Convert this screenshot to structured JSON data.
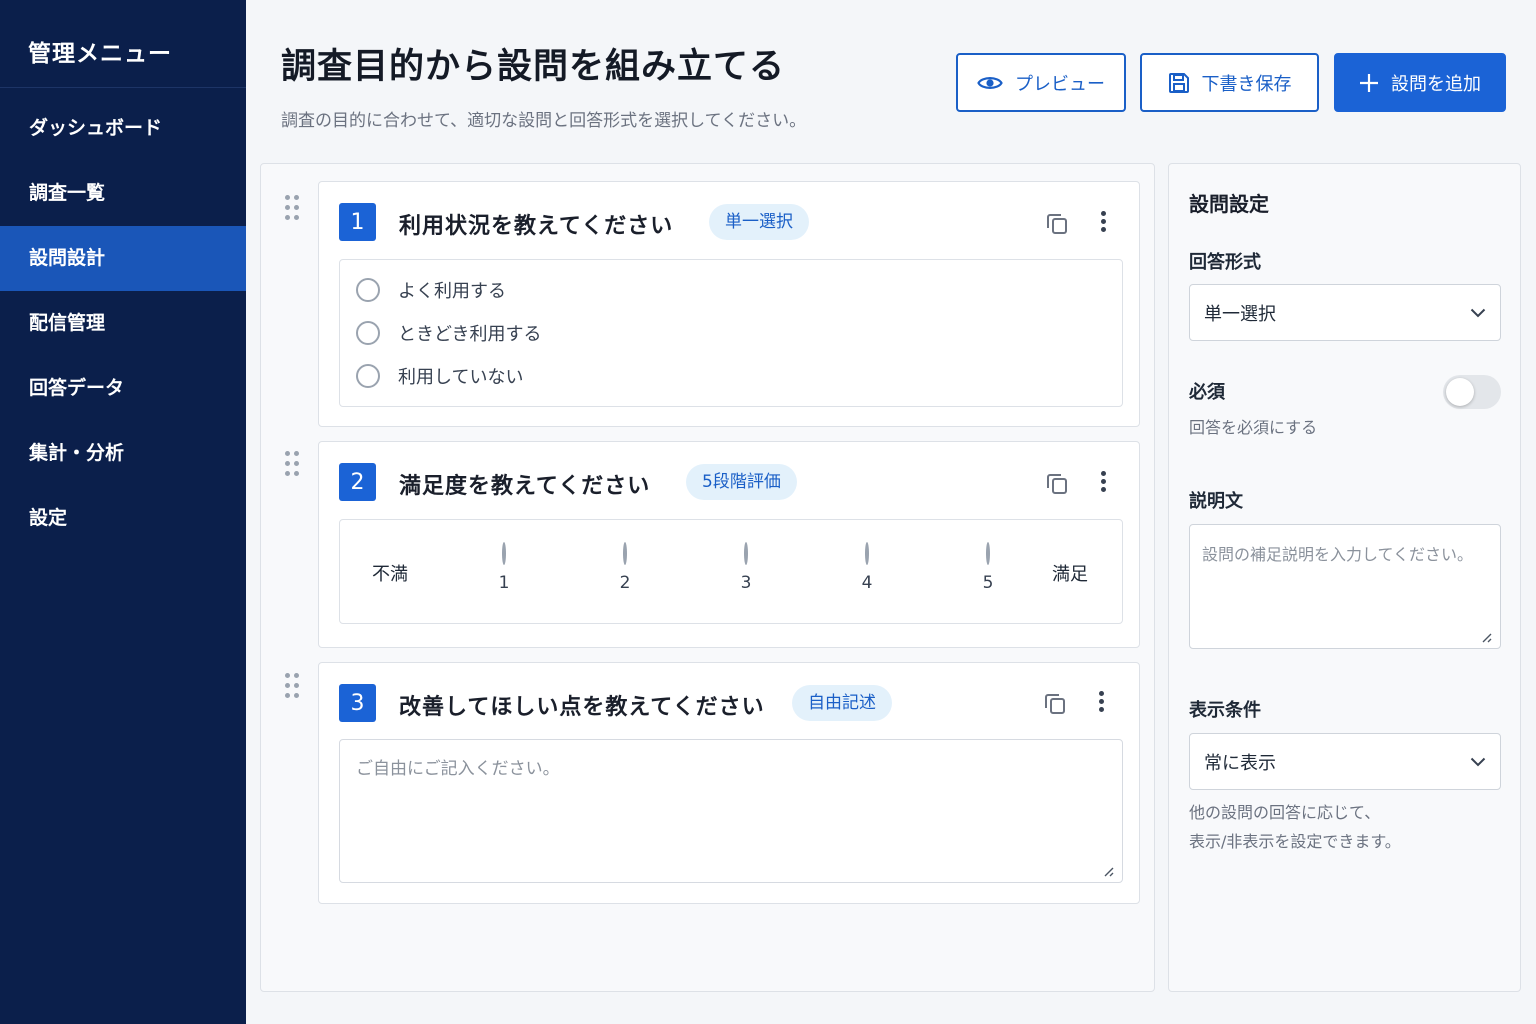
{
  "sidebar": {
    "title": "管理メニュー",
    "items": [
      {
        "label": "ダッシュボード"
      },
      {
        "label": "調査一覧"
      },
      {
        "label": "設問設計"
      },
      {
        "label": "配信管理"
      },
      {
        "label": "回答データ"
      },
      {
        "label": "集計・分析"
      },
      {
        "label": "設定"
      }
    ],
    "active_index": 2
  },
  "header": {
    "title": "調査目的から設問を組み立てる",
    "subtitle": "調査の目的に合わせて、適切な設問と回答形式を選択してください。"
  },
  "toolbar": {
    "preview_label": "プレビュー",
    "save_draft_label": "下書き保存",
    "add_question_label": "設問を追加"
  },
  "questions": [
    {
      "number": "1",
      "title": "利用状況を教えてください",
      "type_badge": "単一選択",
      "options": [
        "よく利用する",
        "ときどき利用する",
        "利用していない"
      ]
    },
    {
      "number": "2",
      "title": "満足度を教えてください",
      "type_badge": "5段階評価",
      "scale": {
        "low_label": "不満",
        "high_label": "満足",
        "points": [
          "1",
          "2",
          "3",
          "4",
          "5"
        ]
      }
    },
    {
      "number": "3",
      "title": "改善してほしい点を教えてください",
      "type_badge": "自由記述",
      "placeholder": "ご自由にご記入ください。"
    }
  ],
  "settings": {
    "title": "設問設定",
    "answer_format_label": "回答形式",
    "answer_format_value": "単一選択",
    "required_label": "必須",
    "required_on": false,
    "required_help": "回答を必須にする",
    "description_label": "説明文",
    "description_placeholder": "設問の補足説明を入力してください。",
    "display_condition_label": "表示条件",
    "display_condition_value": "常に表示",
    "display_condition_help_1": "他の設問の回答に応じて、",
    "display_condition_help_2": "表示/非表示を設定できます。"
  },
  "colors": {
    "sidebar_bg": "#0b1f4b",
    "accent": "#1b63d6",
    "badge_bg": "#e3f1fb"
  }
}
